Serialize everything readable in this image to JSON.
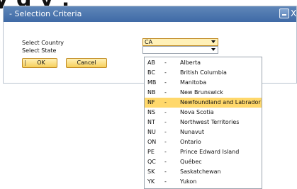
{
  "banner": {
    "text": "y g y ,  "
  },
  "window": {
    "title": "- Selection Criteria",
    "buttons": {
      "minimize": "minimize-icon",
      "close": "X"
    }
  },
  "form": {
    "country_label": "Select Country",
    "state_label": "Select State",
    "country_value": "CA",
    "state_value": "",
    "ok_label": "OK",
    "cancel_label": "Cancel"
  },
  "state_options": [
    {
      "code": "AB",
      "name": "Alberta"
    },
    {
      "code": "BC",
      "name": "British Columbia"
    },
    {
      "code": "MB",
      "name": "Manitoba"
    },
    {
      "code": "NB",
      "name": "New Brunswick"
    },
    {
      "code": "NF",
      "name": "Newfoundland and Labrador"
    },
    {
      "code": "NS",
      "name": "Nova Scotia"
    },
    {
      "code": "NT",
      "name": "Northwest Territories"
    },
    {
      "code": "NU",
      "name": "Nunavut"
    },
    {
      "code": "ON",
      "name": "Ontario"
    },
    {
      "code": "PE",
      "name": "Prince Edward Island"
    },
    {
      "code": "QC",
      "name": "Québec"
    },
    {
      "code": "SK",
      "name": "Saskatchewan"
    },
    {
      "code": "YK",
      "name": "Yukon"
    }
  ],
  "highlighted_index": 4,
  "separator": "-",
  "colors": {
    "titlebar": "#4f79b1",
    "button_fill": "#f6cf5a",
    "highlight": "#ffd86b"
  }
}
